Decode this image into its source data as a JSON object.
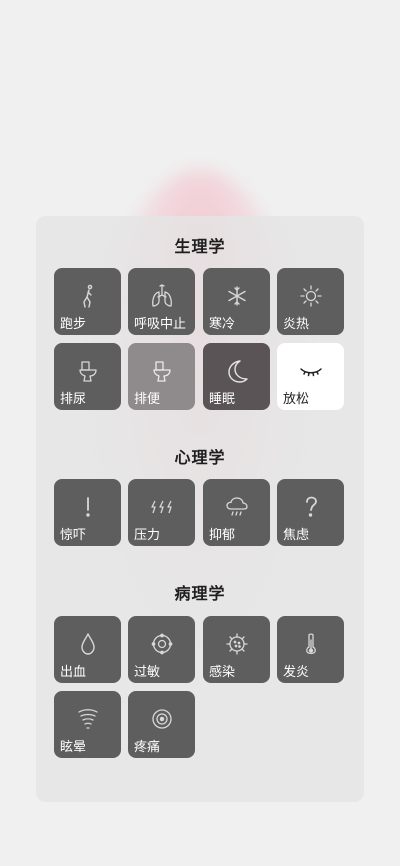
{
  "sections": [
    {
      "title": "生理学",
      "items": [
        {
          "label": "跑步",
          "icon": "running-icon",
          "state": "normal"
        },
        {
          "label": "呼吸中止",
          "icon": "lungs-icon",
          "state": "normal"
        },
        {
          "label": "寒冷",
          "icon": "snowflake-icon",
          "state": "normal"
        },
        {
          "label": "炎热",
          "icon": "sun-icon",
          "state": "normal"
        },
        {
          "label": "排尿",
          "icon": "toilet-icon",
          "state": "normal"
        },
        {
          "label": "排便",
          "icon": "toilet-icon",
          "state": "dimmed"
        },
        {
          "label": "睡眠",
          "icon": "moon-icon",
          "state": "muted"
        },
        {
          "label": "放松",
          "icon": "closed-eye-icon",
          "state": "active"
        }
      ]
    },
    {
      "title": "心理学",
      "items": [
        {
          "label": "惊吓",
          "icon": "exclamation-icon",
          "state": "normal"
        },
        {
          "label": "压力",
          "icon": "lightning-icon",
          "state": "normal"
        },
        {
          "label": "抑郁",
          "icon": "rain-cloud-icon",
          "state": "normal"
        },
        {
          "label": "焦虑",
          "icon": "question-icon",
          "state": "normal"
        }
      ]
    },
    {
      "title": "病理学",
      "items": [
        {
          "label": "出血",
          "icon": "blood-drop-icon",
          "state": "normal"
        },
        {
          "label": "过敏",
          "icon": "pollen-icon",
          "state": "normal"
        },
        {
          "label": "感染",
          "icon": "virus-icon",
          "state": "normal"
        },
        {
          "label": "发炎",
          "icon": "thermometer-icon",
          "state": "normal"
        },
        {
          "label": "眩晕",
          "icon": "dizzy-icon",
          "state": "normal"
        },
        {
          "label": "疼痛",
          "icon": "pain-target-icon",
          "state": "normal"
        }
      ]
    }
  ]
}
